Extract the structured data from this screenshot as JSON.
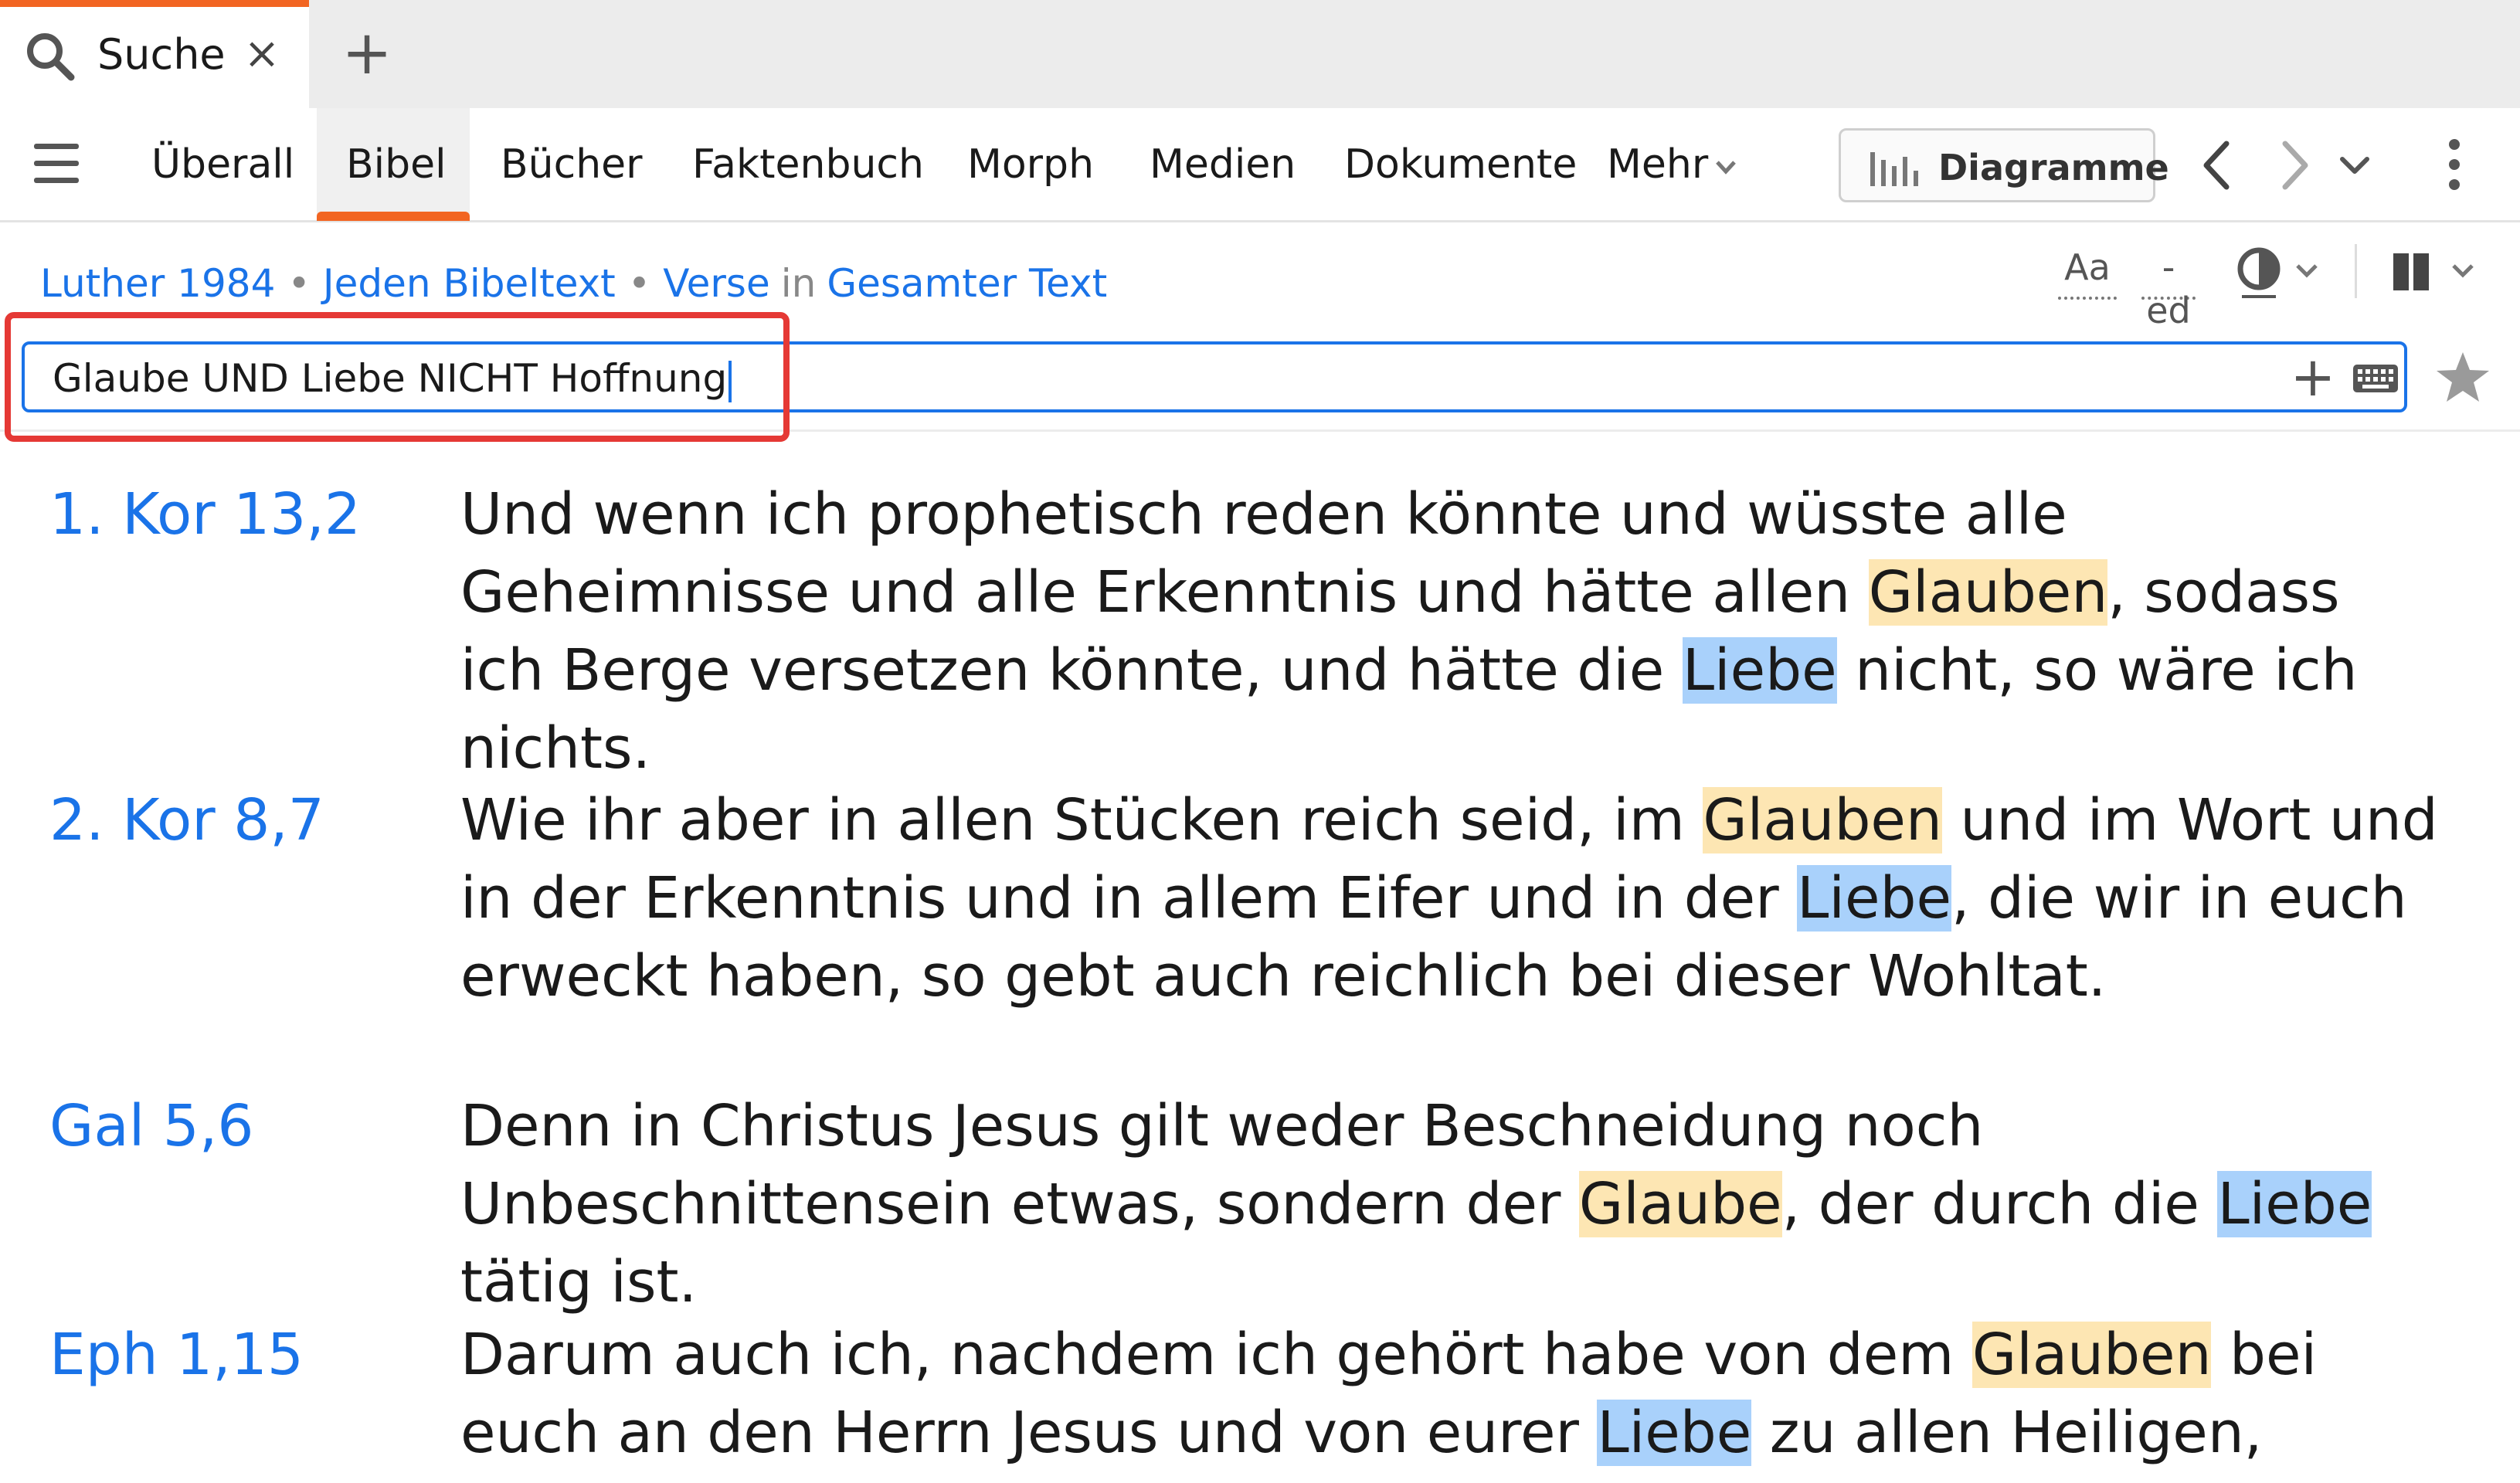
{
  "tab": {
    "label": "Suche",
    "close": "×",
    "add": "+"
  },
  "nav": {
    "items": [
      "Überall",
      "Bibel",
      "Bücher",
      "Faktenbuch",
      "Morph",
      "Medien",
      "Dokumente"
    ],
    "more": "Mehr",
    "active": "Bibel"
  },
  "toolbar": {
    "diagram_label": "Diagramme"
  },
  "breadcrumb": {
    "version": "Luther 1984",
    "dot": "•",
    "scope": "Jeden Bibeltext",
    "unit": "Verse",
    "in": "in",
    "range": "Gesamter Text"
  },
  "tools": {
    "font": "Aa",
    "ed": "-ed"
  },
  "search": {
    "value": "Glaube UND Liebe NICHT Hoffnung",
    "plus": "+"
  },
  "results": [
    {
      "ref": "1. Kor 13,2",
      "segments": [
        {
          "t": "Und wenn ich prophetisch reden könnte und wüsste alle Geheimnisse und alle Erkenntnis und hätte allen ",
          "h": ""
        },
        {
          "t": "Glauben",
          "h": "g"
        },
        {
          "t": ", sodass ich Berge versetzen könnte, und hätte die ",
          "h": ""
        },
        {
          "t": "Liebe",
          "h": "l"
        },
        {
          "t": " nicht, so wäre ich nichts.",
          "h": ""
        }
      ]
    },
    {
      "ref": "2. Kor 8,7",
      "segments": [
        {
          "t": "Wie ihr aber in allen Stücken reich seid, im ",
          "h": ""
        },
        {
          "t": "Glauben",
          "h": "g"
        },
        {
          "t": " und im Wort und in der Erkenntnis und in allem Eifer und in der ",
          "h": ""
        },
        {
          "t": "Liebe",
          "h": "l"
        },
        {
          "t": ", die wir in euch erweckt haben, so gebt auch reichlich bei dieser Wohltat.",
          "h": ""
        }
      ]
    },
    {
      "ref": "Gal 5,6",
      "segments": [
        {
          "t": "Denn in Christus Jesus gilt weder Beschneidung noch Unbeschnittensein etwas, sondern der ",
          "h": ""
        },
        {
          "t": "Glaube",
          "h": "g"
        },
        {
          "t": ", der durch die ",
          "h": ""
        },
        {
          "t": "Liebe",
          "h": "l"
        },
        {
          "t": " tätig ist.",
          "h": ""
        }
      ]
    },
    {
      "ref": "Eph 1,15",
      "segments": [
        {
          "t": "Darum auch ich, nachdem ich gehört habe von dem ",
          "h": ""
        },
        {
          "t": "Glauben",
          "h": "g"
        },
        {
          "t": " bei euch an den Herrn Jesus und von eurer ",
          "h": ""
        },
        {
          "t": "Liebe",
          "h": "l"
        },
        {
          "t": " zu allen Heiligen,",
          "h": ""
        }
      ]
    }
  ],
  "colors": {
    "accent": "#f26522",
    "link": "#1a73e8",
    "highlight_glaube": "#fde6b3",
    "highlight_liebe": "#a9d1fb",
    "annotation_frame": "#e53935"
  },
  "icons": {
    "tab": "search-icon",
    "menu": "hamburger-icon",
    "diagram": "bar-chart-icon",
    "back": "chevron-left-icon",
    "forward": "chevron-right-icon",
    "history": "chevron-down-icon",
    "more": "kebab-icon",
    "theme": "half-circle-icon",
    "layout": "columns-icon",
    "keyboard": "keyboard-icon",
    "favorite": "star-icon"
  }
}
